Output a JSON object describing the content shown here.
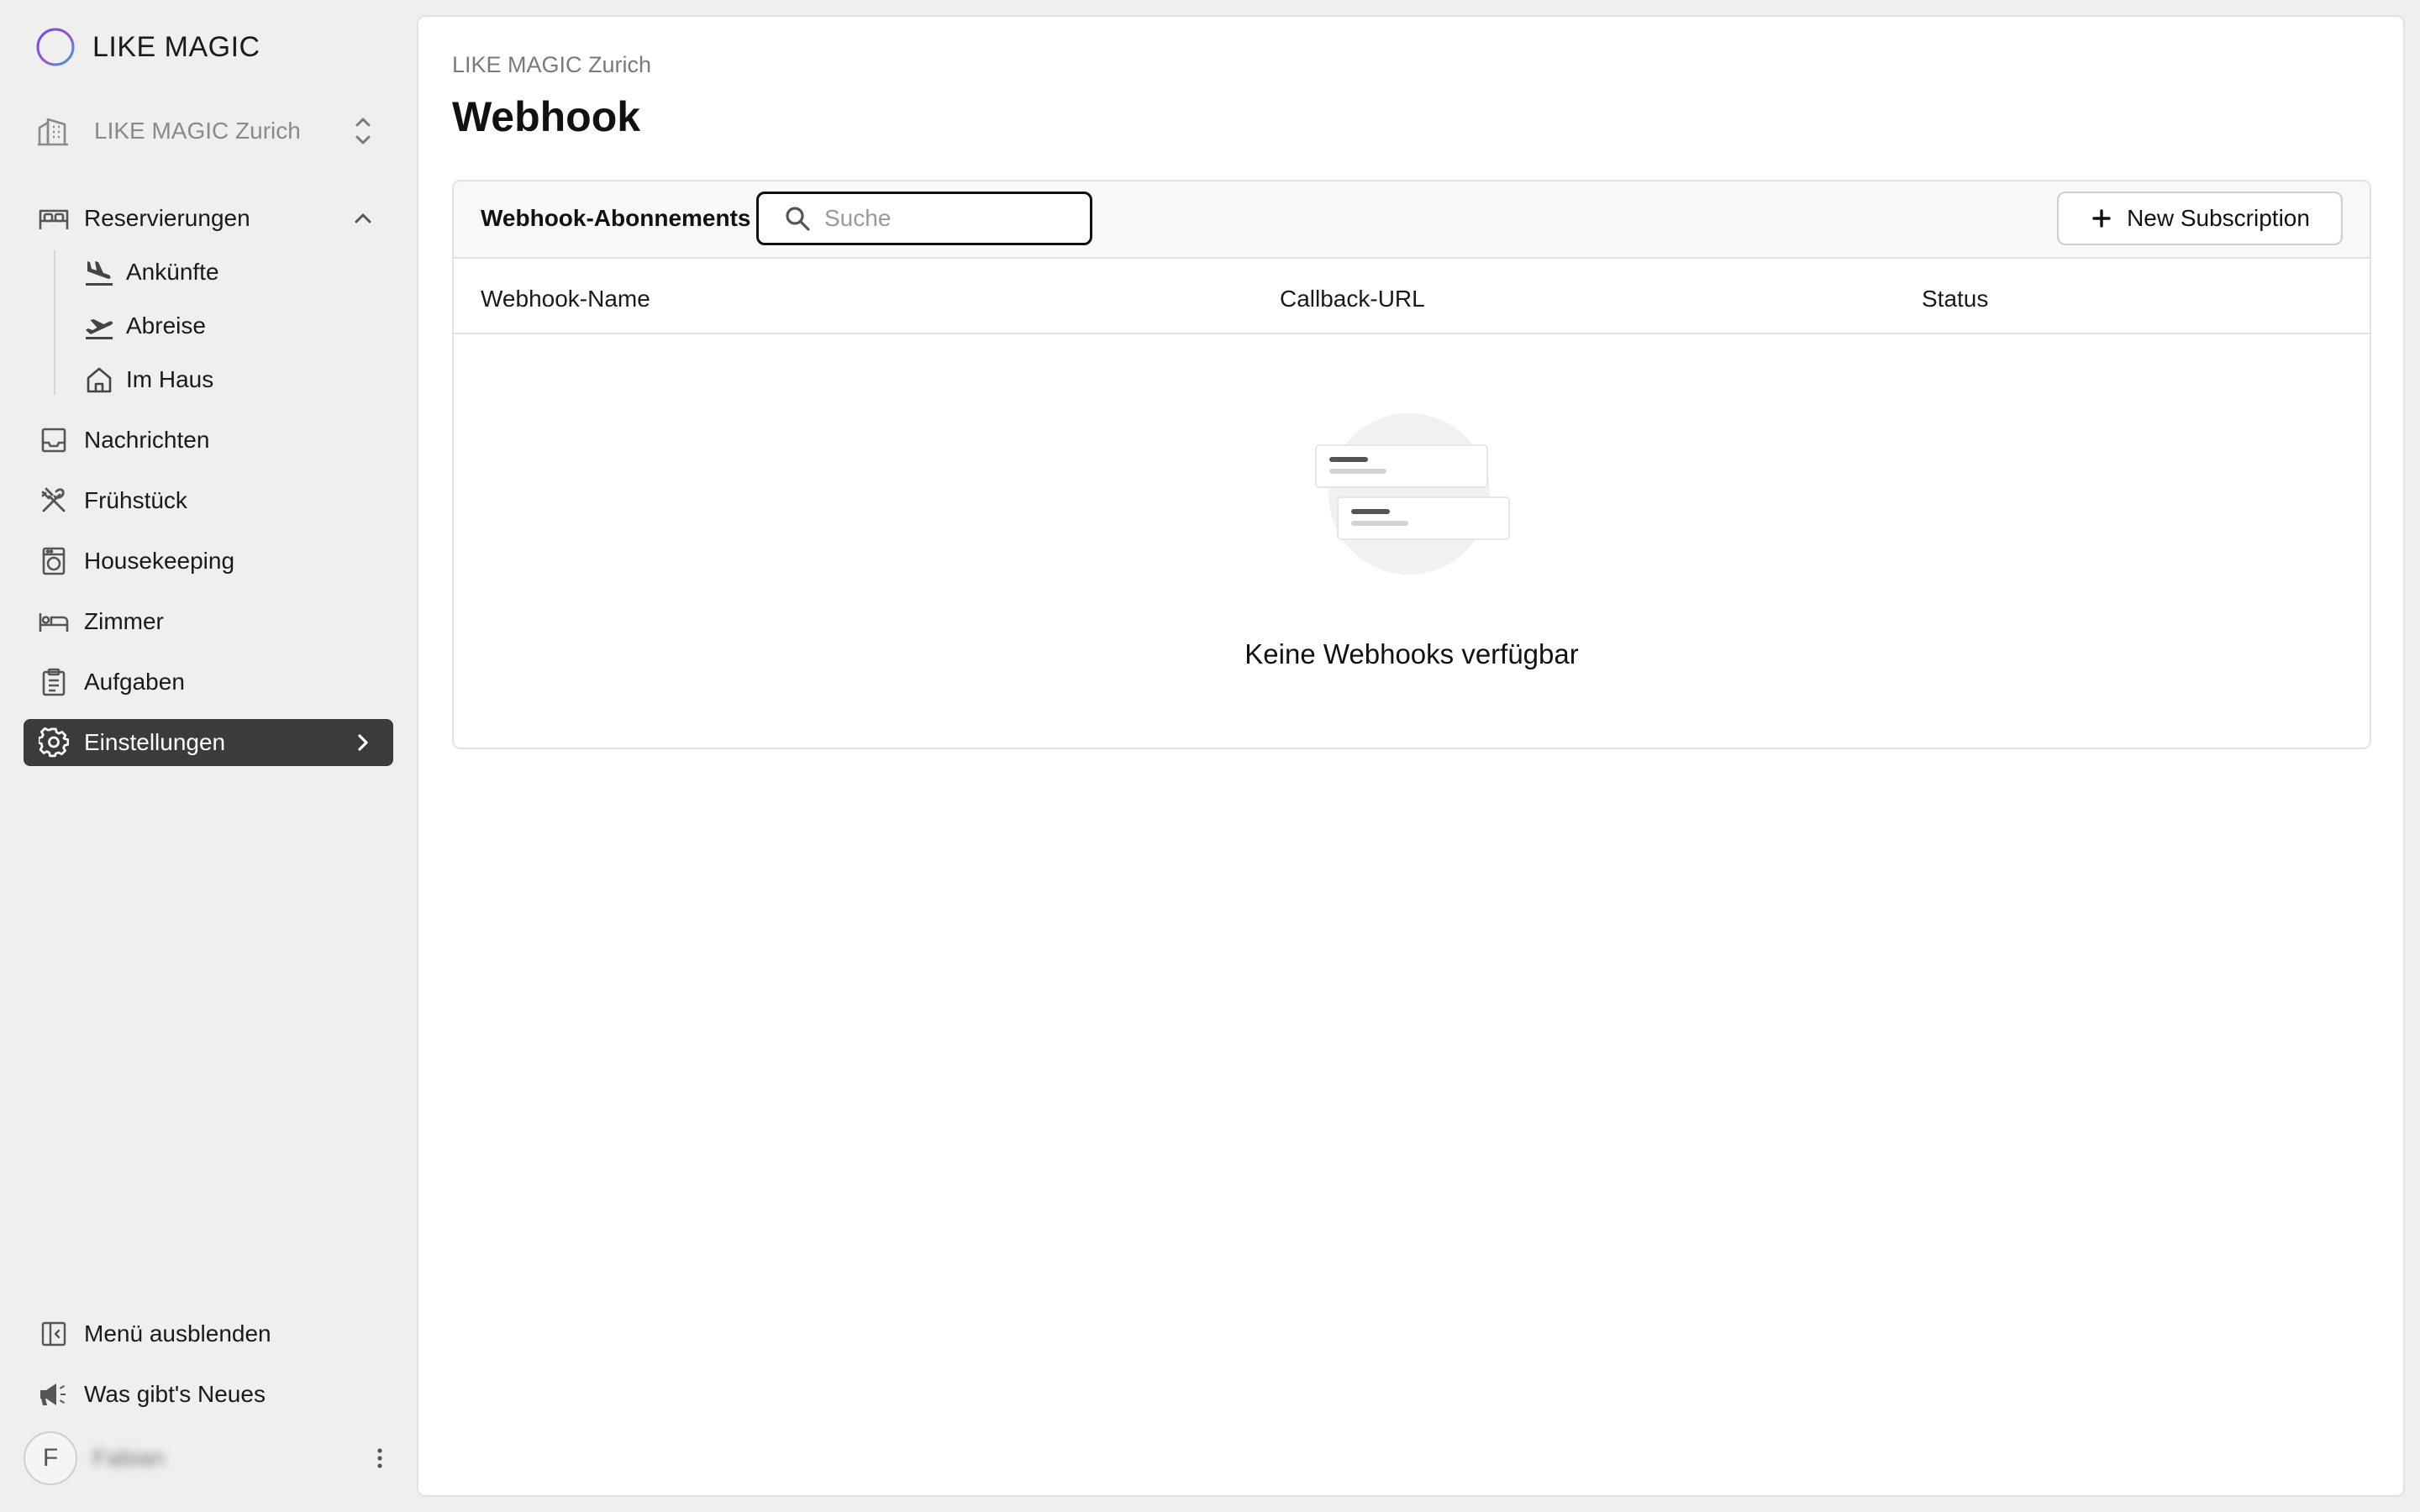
{
  "brand": {
    "name": "LIKE MAGIC"
  },
  "property_selector": {
    "label": "LIKE MAGIC Zurich"
  },
  "sidebar": {
    "reservations": {
      "label": "Reservierungen",
      "children": [
        {
          "label": "Ankünfte",
          "icon": "plane-landing-icon"
        },
        {
          "label": "Abreise",
          "icon": "plane-takeoff-icon"
        },
        {
          "label": "Im Haus",
          "icon": "home-icon"
        }
      ]
    },
    "items": [
      {
        "label": "Nachrichten",
        "icon": "inbox-icon"
      },
      {
        "label": "Frühstück",
        "icon": "cutlery-icon"
      },
      {
        "label": "Housekeeping",
        "icon": "washing-machine-icon"
      },
      {
        "label": "Zimmer",
        "icon": "bed-icon"
      },
      {
        "label": "Aufgaben",
        "icon": "clipboard-icon"
      },
      {
        "label": "Einstellungen",
        "icon": "gear-icon",
        "active": true
      }
    ],
    "footer": {
      "collapse_label": "Menü ausblenden",
      "whats_new_label": "Was gibt's Neues",
      "user_initial": "F",
      "user_name": "Fabian"
    }
  },
  "main": {
    "breadcrumb": "LIKE MAGIC Zurich",
    "title": "Webhook",
    "card": {
      "title": "Webhook-Abonnements",
      "search_placeholder": "Suche",
      "new_button_label": "New Subscription",
      "columns": [
        "Webhook-Name",
        "Callback-URL",
        "Status"
      ],
      "rows": [],
      "empty_text": "Keine Webhooks verfügbar"
    }
  },
  "colors": {
    "active_nav_bg": "#3b3b3b",
    "sidebar_bg": "#efefef",
    "content_bg": "#ffffff"
  }
}
